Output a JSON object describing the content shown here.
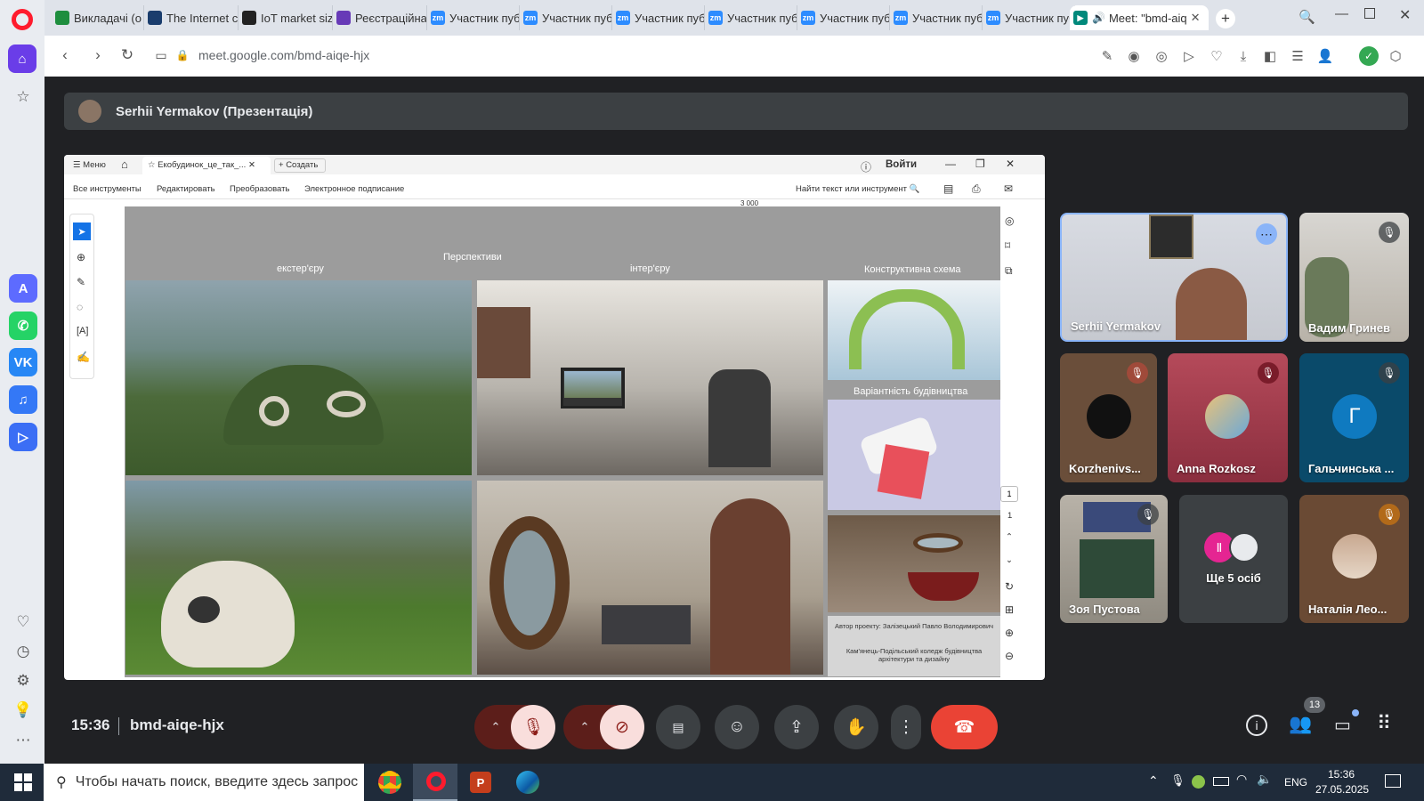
{
  "browser": {
    "tabs": [
      {
        "label": "Викладачі (о",
        "color": "#1e8e3e",
        "icon": "sheets-icon"
      },
      {
        "label": "The Internet c",
        "color": "#1a3d6d",
        "icon": "m-icon"
      },
      {
        "label": "IoT market siz",
        "color": "#222",
        "icon": "bolt-icon"
      },
      {
        "label": "Реєстраційна",
        "color": "#673ab7",
        "icon": "forms-icon"
      },
      {
        "label": "Участник пуб",
        "color": "#2d8cff",
        "icon": "zoom-icon"
      },
      {
        "label": "Участник пуб",
        "color": "#2d8cff",
        "icon": "zoom-icon"
      },
      {
        "label": "Участник пуб",
        "color": "#2d8cff",
        "icon": "zoom-icon"
      },
      {
        "label": "Участник пуб",
        "color": "#2d8cff",
        "icon": "zoom-icon"
      },
      {
        "label": "Участник пуб",
        "color": "#2d8cff",
        "icon": "zoom-icon"
      },
      {
        "label": "Участник пуб",
        "color": "#2d8cff",
        "icon": "zoom-icon"
      },
      {
        "label": "Участник пуб",
        "color": "#2d8cff",
        "icon": "zoom-icon"
      }
    ],
    "active_tab": "Meet: \"bmd-aiq",
    "url": "meet.google.com/bmd-aiqe-hjx",
    "zoom_badge": "zm"
  },
  "meet": {
    "presenter_title": "Serhii Yermakov (Презентація)",
    "time": "15:36",
    "code": "bmd-aiqe-hjx",
    "people_count": "13",
    "participants": [
      {
        "name": "Serhii Yermakov",
        "muted": false
      },
      {
        "name": "Вадим Гринев",
        "muted": true
      },
      {
        "name": "Korzhenivs...",
        "muted": true
      },
      {
        "name": "Anna Rozkosz",
        "muted": true
      },
      {
        "name": "Гальчинська ...",
        "muted": true,
        "initial": "Г"
      },
      {
        "name": "Зоя Пустова",
        "muted": true
      },
      {
        "name": "Наталія Лео...",
        "muted": true
      }
    ],
    "more_people": "Ще 5 осіб"
  },
  "doc": {
    "menu": "Меню",
    "tab": "Екобудинок_це_так_...",
    "create": "Создать",
    "login": "Войти",
    "tools": [
      "Все инструменты",
      "Редактировать",
      "Преобразовать",
      "Электронное подписание"
    ],
    "find": "Найти текст или инструмент",
    "page_num": "1",
    "page_total": "1",
    "dim_label": "3 000"
  },
  "slide": {
    "title": "Перспективи",
    "exterior": "екстер'єру",
    "interior": "інтер'єру",
    "construct": "Конструктивна схема",
    "variants": "Варіантність  будівництва",
    "author": "Автор проекту: Залізецький Павло Володимирович",
    "college": "Кам'янець-Подільський коледж будівництва архітектури та дизайну"
  },
  "taskbar": {
    "search_placeholder": "Чтобы начать поиск, введите здесь запрос",
    "lang": "ENG",
    "time": "15:36",
    "date": "27.05.2025"
  }
}
